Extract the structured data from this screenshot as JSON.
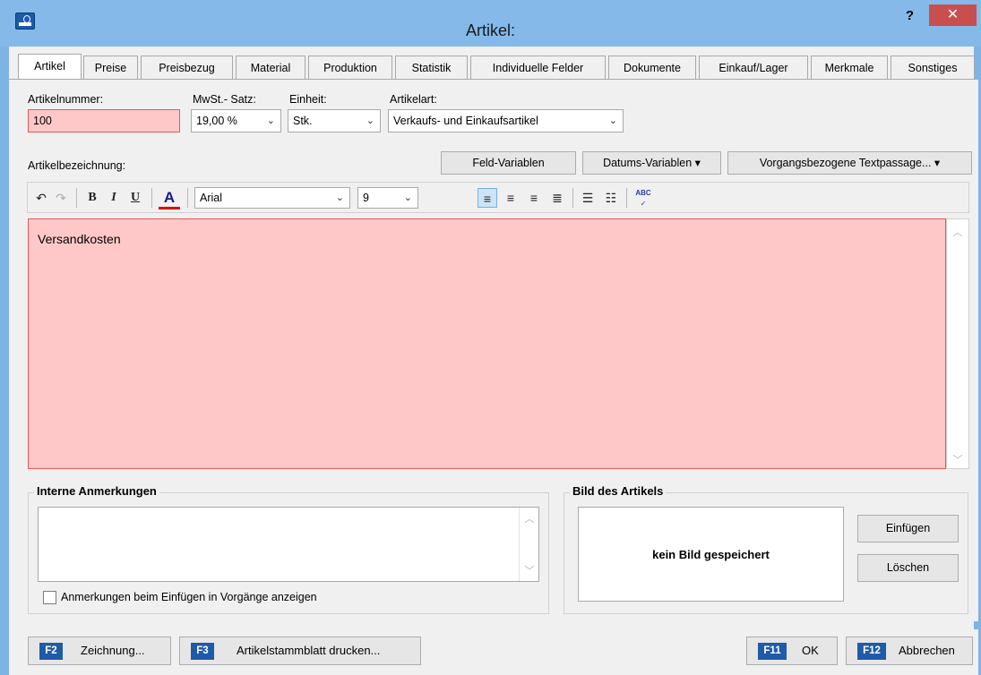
{
  "window": {
    "title": "Artikel:",
    "help_label": "?",
    "close_label": "✕"
  },
  "tabs": [
    {
      "label": "Artikel",
      "active": true
    },
    {
      "label": "Preise"
    },
    {
      "label": "Preisbezug"
    },
    {
      "label": "Material"
    },
    {
      "label": "Produktion"
    },
    {
      "label": "Statistik"
    },
    {
      "label": "Individuelle Felder"
    },
    {
      "label": "Dokumente"
    },
    {
      "label": "Einkauf/Lager"
    },
    {
      "label": "Merkmale"
    },
    {
      "label": "Sonstiges"
    }
  ],
  "form": {
    "artikelnummer_label": "Artikelnummer:",
    "artikelnummer_value": "100",
    "mwst_label": "MwSt.- Satz:",
    "mwst_value": "19,00 %",
    "einheit_label": "Einheit:",
    "einheit_value": "Stk.",
    "artikelart_label": "Artikelart:",
    "artikelart_value": "Verkaufs- und Einkaufsartikel",
    "bezeichnung_label": "Artikelbezeichnung:"
  },
  "variable_buttons": {
    "feld": "Feld-Variablen",
    "datum": "Datums-Variablen ▾",
    "vorgang": "Vorgangsbezogene Textpassage... ▾"
  },
  "toolbar": {
    "font_value": "Arial",
    "size_value": "9",
    "bold": "B",
    "italic": "I",
    "underline": "U",
    "color": "A",
    "spell": "ABC"
  },
  "editor": {
    "text": "Versandkosten"
  },
  "notes": {
    "title": "Interne Anmerkungen",
    "checkbox_label": "Anmerkungen beim Einfügen in Vorgänge anzeigen"
  },
  "image": {
    "title": "Bild des Artikels",
    "empty_text": "kein Bild gespeichert",
    "insert_label": "Einfügen",
    "delete_label": "Löschen"
  },
  "footer": {
    "f2_key": "F2",
    "f2_label": "Zeichnung...",
    "f3_key": "F3",
    "f3_label": "Artikelstammblatt drucken...",
    "f11_key": "F11",
    "f11_label": "OK",
    "f12_key": "F12",
    "f12_label": "Abbrechen"
  },
  "colors": {
    "titlebar": "#84b9ea",
    "required_field": "#ffc8c8",
    "close": "#c94f4f",
    "fkey": "#1f5ba8"
  }
}
